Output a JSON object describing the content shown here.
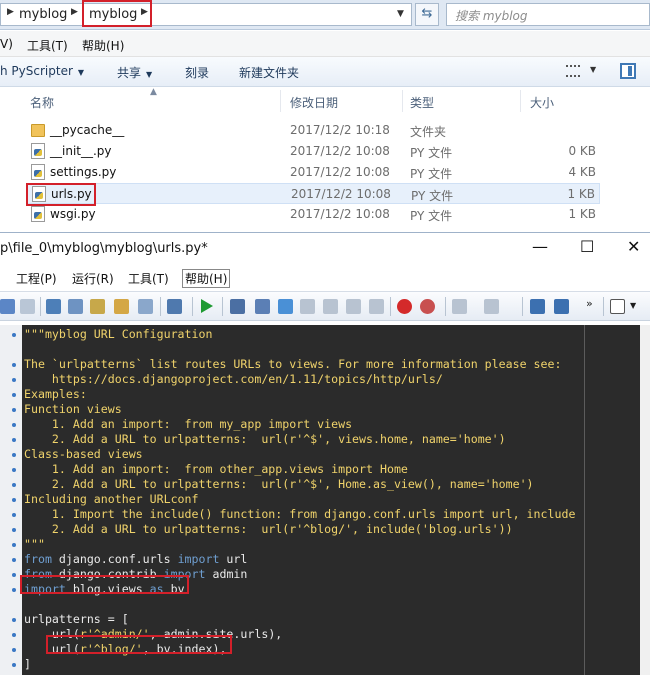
{
  "explorer": {
    "breadcrumbs": [
      "myblog",
      "myblog"
    ],
    "search_placeholder": "搜索 myblog",
    "menu": [
      "V)",
      "工具(T)",
      "帮助(H)"
    ],
    "commands": {
      "open_with": "h PyScripter",
      "share": "共享",
      "burn": "刻录",
      "new_folder": "新建文件夹"
    },
    "columns": [
      "名称",
      "修改日期",
      "类型",
      "大小"
    ],
    "files": [
      {
        "name": "__pycache__",
        "date": "2017/12/2 10:18",
        "type": "文件夹",
        "size": "",
        "kind": "folder"
      },
      {
        "name": "__init__.py",
        "date": "2017/12/2 10:08",
        "type": "PY 文件",
        "size": "0 KB",
        "kind": "py"
      },
      {
        "name": "settings.py",
        "date": "2017/12/2 10:08",
        "type": "PY 文件",
        "size": "4 KB",
        "kind": "py"
      },
      {
        "name": "urls.py",
        "date": "2017/12/2 10:08",
        "type": "PY 文件",
        "size": "1 KB",
        "kind": "py",
        "selected": true
      },
      {
        "name": "wsgi.py",
        "date": "2017/12/2 10:08",
        "type": "PY 文件",
        "size": "1 KB",
        "kind": "py"
      }
    ]
  },
  "pyscripter": {
    "title": "p\\file_0\\myblog\\myblog\\urls.py*",
    "window_buttons": [
      "—",
      "☐",
      "✕"
    ],
    "menu": [
      "工程(P)",
      "运行(R)",
      "工具(T)",
      "帮助(H)"
    ],
    "code_lines": [
      {
        "text": "\"\"\"myblog URL Configuration",
        "style": "doc",
        "bullet": true
      },
      {
        "text": "",
        "style": "doc",
        "bullet": false
      },
      {
        "text": "The `urlpatterns` list routes URLs to views. For more information please see:",
        "style": "doc",
        "bullet": true
      },
      {
        "text": "    https://docs.djangoproject.com/en/1.11/topics/http/urls/",
        "style": "doc",
        "bullet": true
      },
      {
        "text": "Examples:",
        "style": "doc",
        "bullet": true
      },
      {
        "text": "Function views",
        "style": "doc",
        "bullet": true
      },
      {
        "text": "    1. Add an import:  from my_app import views",
        "style": "doc",
        "bullet": true
      },
      {
        "text": "    2. Add a URL to urlpatterns:  url(r'^$', views.home, name='home')",
        "style": "doc",
        "bullet": true
      },
      {
        "text": "Class-based views",
        "style": "doc",
        "bullet": true
      },
      {
        "text": "    1. Add an import:  from other_app.views import Home",
        "style": "doc",
        "bullet": true
      },
      {
        "text": "    2. Add a URL to urlpatterns:  url(r'^$', Home.as_view(), name='home')",
        "style": "doc",
        "bullet": true
      },
      {
        "text": "Including another URLconf",
        "style": "doc",
        "bullet": true
      },
      {
        "text": "    1. Import the include() function: from django.conf.urls import url, include",
        "style": "doc",
        "bullet": true
      },
      {
        "text": "    2. Add a URL to urlpatterns:  url(r'^blog/', include('blog.urls'))",
        "style": "doc",
        "bullet": true
      },
      {
        "text": "\"\"\"",
        "style": "doc",
        "bullet": true
      },
      {
        "parts": [
          {
            "t": "from",
            "c": "kw"
          },
          {
            "t": " django.conf.urls ",
            "c": ""
          },
          {
            "t": "import",
            "c": "kw"
          },
          {
            "t": " url",
            "c": ""
          }
        ],
        "bullet": true
      },
      {
        "parts": [
          {
            "t": "from",
            "c": "kw"
          },
          {
            "t": " django.contrib ",
            "c": ""
          },
          {
            "t": "import",
            "c": "kw"
          },
          {
            "t": " admin",
            "c": ""
          }
        ],
        "bullet": true
      },
      {
        "parts": [
          {
            "t": "import",
            "c": "kw"
          },
          {
            "t": " blog.views ",
            "c": ""
          },
          {
            "t": "as",
            "c": "kw"
          },
          {
            "t": " bv",
            "c": ""
          }
        ],
        "bullet": true
      },
      {
        "text": "",
        "style": "",
        "bullet": false
      },
      {
        "text": "urlpatterns = [",
        "style": "",
        "bullet": true
      },
      {
        "parts": [
          {
            "t": "    url(",
            "c": ""
          },
          {
            "t": "r'^admin/'",
            "c": "doc"
          },
          {
            "t": ", admin.site.urls),",
            "c": ""
          }
        ],
        "bullet": true
      },
      {
        "parts": [
          {
            "t": "    url(",
            "c": ""
          },
          {
            "t": "r'^blog/'",
            "c": "doc"
          },
          {
            "t": ", bv.index),",
            "c": ""
          }
        ],
        "bullet": true
      },
      {
        "text": "]",
        "style": "",
        "bullet": true
      }
    ]
  },
  "colors": {
    "highlight_red": "#d3202a",
    "editor_bg": "#2b2b2b",
    "docstring": "#f0d36b",
    "keyword": "#6f9fd1"
  }
}
